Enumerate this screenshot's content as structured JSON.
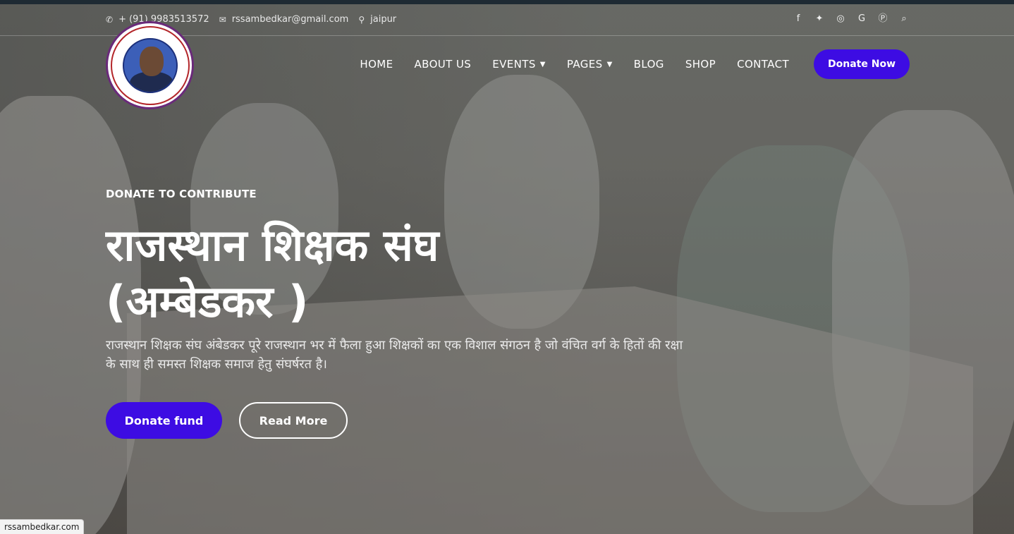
{
  "topbar": {
    "phone": "+ (91) 9983513572",
    "email": "rssambedkar@gmail.com",
    "location": "jaipur",
    "icons": {
      "phone": "phone-icon",
      "email": "envelope-icon",
      "location": "map-marker-icon"
    },
    "socials": [
      "facebook-icon",
      "twitter-icon",
      "instagram-icon",
      "google-icon",
      "pinterest-icon",
      "search-icon"
    ]
  },
  "nav": {
    "items": [
      {
        "label": "HOME"
      },
      {
        "label": "ABOUT US"
      },
      {
        "label": "EVENTS"
      },
      {
        "label": "PAGES"
      },
      {
        "label": "BLOG"
      },
      {
        "label": "SHOP"
      },
      {
        "label": "CONTACT"
      }
    ],
    "donate_label": "Donate Now"
  },
  "hero": {
    "kicker": "DONATE TO CONTRIBUTE",
    "title": "राजस्थान शिक्षक संघ (अम्बेडकर )",
    "description": "राजस्थान शिक्षक संघ अंबेडकर पूरे राजस्थान भर में फैला हुआ शिक्षकों का एक विशाल संगठन है जो वंचित वर्ग के हितों की रक्षा के साथ ही समस्त शिक्षक समाज हेतु संघर्षरत है।",
    "primary_button": "Donate fund",
    "secondary_button": "Read More"
  },
  "status_bar": {
    "url": "rssambedkar.com"
  },
  "colors": {
    "accent": "#3d0ce3",
    "top_strip": "#1e2a33"
  }
}
